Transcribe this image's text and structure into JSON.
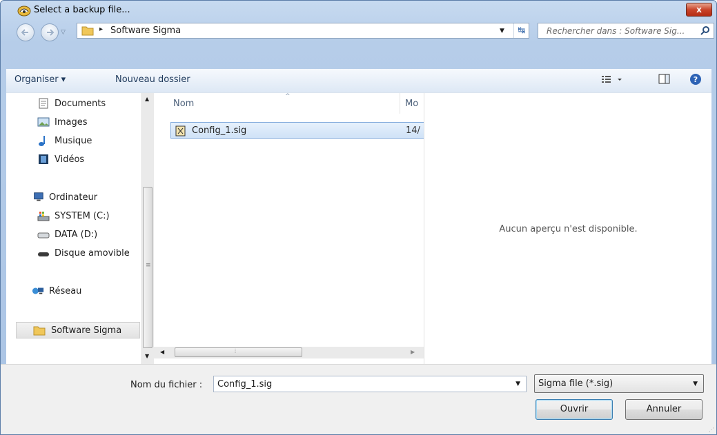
{
  "window": {
    "title": "Select a backup file...",
    "close_label": "x"
  },
  "address": {
    "path": "Software Sigma",
    "separator": "▸"
  },
  "search": {
    "placeholder": "Rechercher dans : Software Sig..."
  },
  "toolbar": {
    "organise": "Organiser ▾",
    "new_folder": "Nouveau dossier"
  },
  "nav": {
    "items": [
      {
        "label": "Documents",
        "icon": "documents-icon"
      },
      {
        "label": "Images",
        "icon": "images-icon"
      },
      {
        "label": "Musique",
        "icon": "music-icon"
      },
      {
        "label": "Vidéos",
        "icon": "videos-icon"
      },
      {
        "label": "Ordinateur",
        "icon": "computer-icon"
      },
      {
        "label": "SYSTEM (C:)",
        "icon": "system-drive-icon"
      },
      {
        "label": "DATA (D:)",
        "icon": "drive-icon"
      },
      {
        "label": "Disque amovible",
        "icon": "removable-drive-icon"
      },
      {
        "label": "Réseau",
        "icon": "network-icon"
      },
      {
        "label": "Software Sigma",
        "icon": "folder-icon",
        "selected": true
      }
    ]
  },
  "files": {
    "columns": [
      "Nom",
      "Mo"
    ],
    "rows": [
      {
        "name": "Config_1.sig",
        "modified": "14/"
      }
    ]
  },
  "preview": {
    "empty_text": "Aucun aperçu n'est disponible."
  },
  "bottom": {
    "filename_label": "Nom du fichier :",
    "filename_value": "Config_1.sig",
    "filetype_value": "Sigma file (*.sig)",
    "open_label": "Ouvrir",
    "cancel_label": "Annuler"
  },
  "colors": {
    "selection": "#cfe2f7",
    "frame": "#b6cde9",
    "accent": "#1e395b"
  }
}
